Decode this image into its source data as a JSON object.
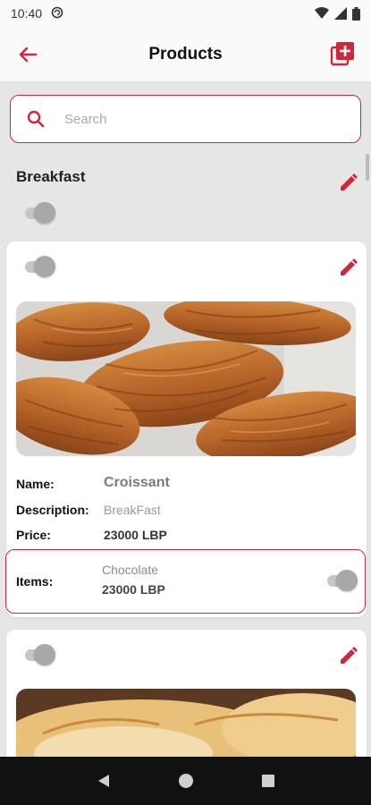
{
  "status_bar": {
    "time": "10:40"
  },
  "app_bar": {
    "title": "Products"
  },
  "search": {
    "placeholder": "Search"
  },
  "category": {
    "title": "Breakfast"
  },
  "product": {
    "labels": {
      "name": "Name:",
      "description": "Description:",
      "price": "Price:",
      "items": "Items:"
    },
    "name": "Croissant",
    "description": "BreakFast",
    "price": "23000 LBP",
    "item": {
      "name": "Chocolate",
      "price": "23000 LBP"
    }
  },
  "colors": {
    "accent": "#d1263a",
    "background": "#e6e6e6"
  },
  "icons": [
    "back-arrow-icon",
    "add-box-icon",
    "search-icon",
    "pencil-icon"
  ]
}
